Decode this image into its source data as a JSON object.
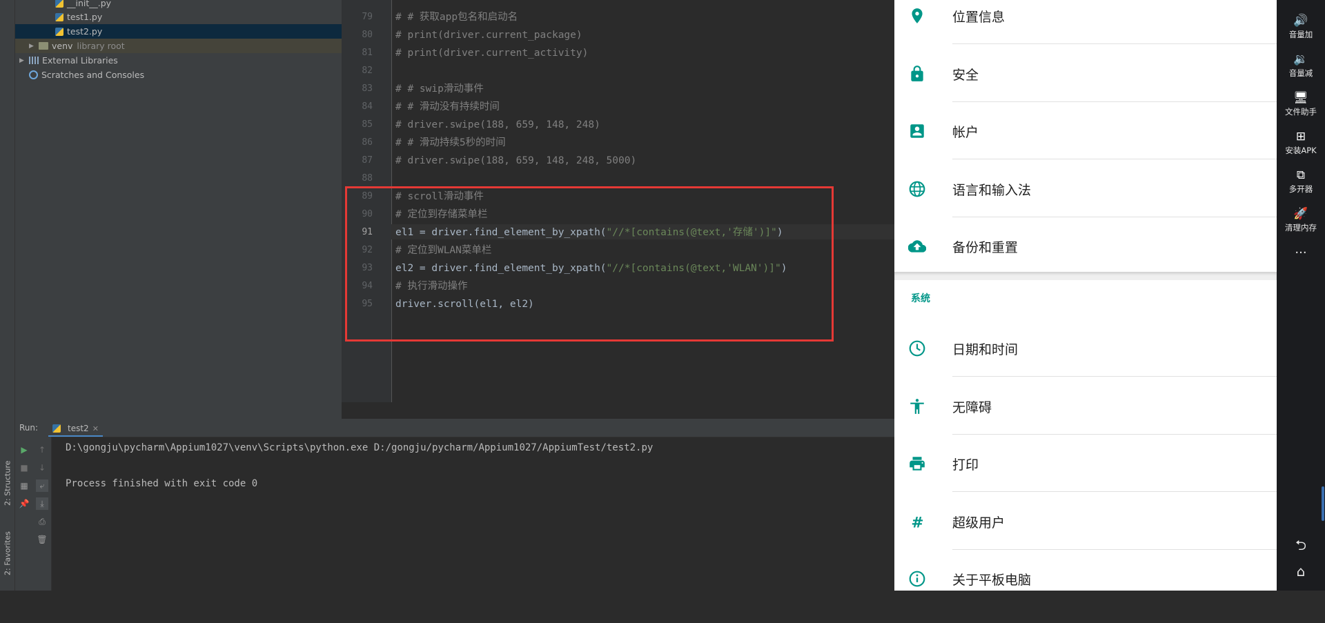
{
  "sidebar_tabs": {
    "structure": "2: Structure",
    "favorites": "2: Favorites"
  },
  "project_tree": {
    "items": [
      {
        "label": "__init__.py",
        "type": "py"
      },
      {
        "label": "test1.py",
        "type": "py"
      },
      {
        "label": "test2.py",
        "type": "py",
        "selected": true
      },
      {
        "label": "venv",
        "hint": "library root",
        "type": "folder"
      },
      {
        "label": "External Libraries",
        "type": "lib"
      },
      {
        "label": "Scratches and Consoles",
        "type": "scratch"
      }
    ]
  },
  "editor": {
    "lines": [
      {
        "no": "79",
        "text": "# # 获取app包名和启动名"
      },
      {
        "no": "80",
        "text": "# print(driver.current_package)"
      },
      {
        "no": "81",
        "text": "# print(driver.current_activity)"
      },
      {
        "no": "82",
        "text": ""
      },
      {
        "no": "83",
        "text": "# # swip滑动事件"
      },
      {
        "no": "84",
        "text": "# # 滑动没有持续时间"
      },
      {
        "no": "85",
        "text": "# driver.swipe(188, 659, 148, 248)"
      },
      {
        "no": "86",
        "text": "# # 滑动持续5秒的时间"
      },
      {
        "no": "87",
        "text": "# driver.swipe(188, 659, 148, 248, 5000)"
      },
      {
        "no": "88",
        "text": ""
      },
      {
        "no": "89",
        "text": "# scroll滑动事件"
      },
      {
        "no": "90",
        "text": "# 定位到存储菜单栏"
      },
      {
        "no": "91",
        "code": "el1 = driver.find_element_by_xpath(",
        "str": "\"//*[contains(@text,'存储')]\"",
        "end": ")"
      },
      {
        "no": "92",
        "text": "# 定位到WLAN菜单栏"
      },
      {
        "no": "93",
        "code": "el2 = driver.find_element_by_xpath(",
        "str": "\"//*[contains(@text,'WLAN')]\"",
        "end": ")"
      },
      {
        "no": "94",
        "text": "# 执行滑动操作"
      },
      {
        "no": "95",
        "code": "driver.scroll(el1, el2)",
        "str": "",
        "end": ""
      }
    ]
  },
  "run_panel": {
    "label": "Run:",
    "tab": "test2",
    "output": [
      "D:\\gongju\\pycharm\\Appium1027\\venv\\Scripts\\python.exe D:/gongju/pycharm/Appium1027/AppiumTest/test2.py",
      "",
      "Process finished with exit code 0"
    ]
  },
  "android": {
    "items_top": [
      {
        "label": "位置信息",
        "icon": "location-icon"
      },
      {
        "label": "安全",
        "icon": "lock-icon"
      },
      {
        "label": "帐户",
        "icon": "account-icon"
      },
      {
        "label": "语言和输入法",
        "icon": "globe-icon"
      },
      {
        "label": "备份和重置",
        "icon": "cloud-upload-icon"
      }
    ],
    "section_system": "系统",
    "items_system": [
      {
        "label": "日期和时间",
        "icon": "clock-icon"
      },
      {
        "label": "无障碍",
        "icon": "accessibility-icon"
      },
      {
        "label": "打印",
        "icon": "printer-icon"
      },
      {
        "label": "超级用户",
        "icon": "hash-icon"
      },
      {
        "label": "关于平板电脑",
        "icon": "info-icon"
      }
    ],
    "accent": "#009688"
  },
  "emulator_bar": {
    "buttons": [
      {
        "label": "音量加",
        "glyph": "🔊"
      },
      {
        "label": "音量减",
        "glyph": "🔉"
      },
      {
        "label": "文件助手",
        "glyph": "🖥"
      },
      {
        "label": "安装APK",
        "glyph": "⊞"
      },
      {
        "label": "多开器",
        "glyph": "⧉"
      },
      {
        "label": "清理内存",
        "glyph": "🚀"
      }
    ],
    "more": "···",
    "back": "⮌",
    "home": "⌂"
  }
}
